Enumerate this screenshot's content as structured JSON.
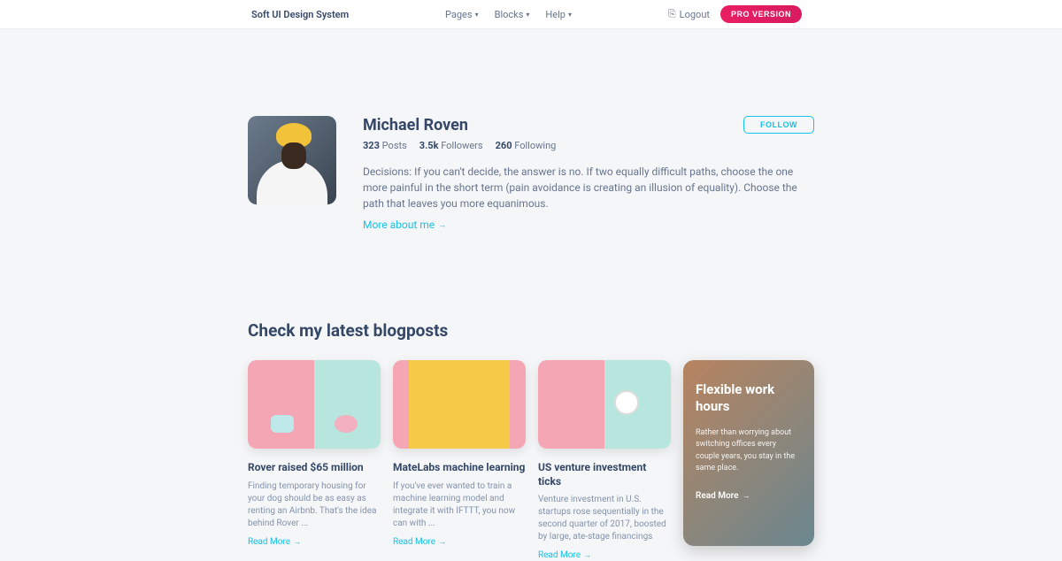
{
  "nav": {
    "brand": "Soft UI Design System",
    "items": [
      "Pages",
      "Blocks",
      "Help"
    ],
    "logout": "Logout",
    "pro": "PRO VERSION"
  },
  "profile": {
    "name": "Michael Roven",
    "follow": "FOLLOW",
    "stats": {
      "posts_n": "323",
      "posts_l": "Posts",
      "followers_n": "3.5k",
      "followers_l": "Followers",
      "following_n": "260",
      "following_l": "Following"
    },
    "bio": "Decisions: If you can't decide, the answer is no. If two equally difficult paths, choose the one more painful in the short term (pain avoidance is creating an illusion of equality). Choose the path that leaves you more equanimous.",
    "more": "More about me"
  },
  "blog": {
    "heading": "Check my latest blogposts",
    "read_more": "Read More",
    "posts": [
      {
        "title": "Rover raised $65 million",
        "desc": "Finding temporary housing for your dog should be as easy as renting an Airbnb. That's the idea behind Rover ..."
      },
      {
        "title": "MateLabs machine learning",
        "desc": "If you've ever wanted to train a machine learning model and integrate it with IFTTT, you now can with ..."
      },
      {
        "title": "US venture investment ticks",
        "desc": "Venture investment in U.S. startups rose sequentially in the second quarter of 2017, boosted by large, ate-stage financings"
      }
    ],
    "overlay": {
      "title": "Flexible work hours",
      "desc": "Rather than worrying about switching offices every couple years, you stay in the same place."
    }
  }
}
